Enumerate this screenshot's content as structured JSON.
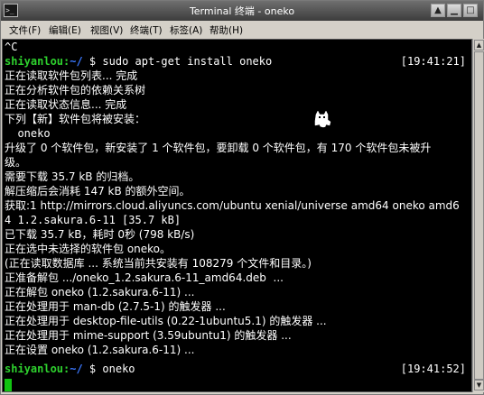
{
  "window": {
    "title": "Terminal 终端 - oneko",
    "app_icon_text": ">_",
    "controls": {
      "shade": "▲",
      "minimize": "▁",
      "maximize": "□",
      "close": "✕"
    }
  },
  "menu": [
    "文件(F)",
    "编辑(E)",
    "视图(V)",
    "终端(T)",
    "标签(A)",
    "帮助(H)"
  ],
  "terminal": {
    "prompt_user": "shiyanlou:",
    "prompt_path": "~/",
    "prompt_symbol": " $ ",
    "lines": [
      "^C",
      "",
      "正在读取软件包列表... 完成",
      "正在分析软件包的依赖关系树",
      "正在读取状态信息... 完成",
      "下列【新】软件包将被安装：",
      "  oneko",
      "升级了 0 个软件包，新安装了 1 个软件包，要卸载 0 个软件包，有 170 个软件包未被升",
      "级。",
      "需要下载 35.7 kB 的归档。",
      "解压缩后会消耗 147 kB 的额外空间。",
      "获取:1 http://mirrors.cloud.aliyuncs.com/ubuntu xenial/universe amd64 oneko amd6",
      "4 1.2.sakura.6-11 [35.7 kB]",
      "已下载 35.7 kB，耗时 0秒 (798 kB/s)",
      "正在选中未选择的软件包 oneko。",
      "(正在读取数据库 ... 系统当前共安装有 108279 个文件和目录。)",
      "正准备解包 .../oneko_1.2.sakura.6-11_amd64.deb  ...",
      "正在解包 oneko (1.2.sakura.6-11) ...",
      "正在处理用于 man-db (2.7.5-1) 的触发器 ...",
      "正在处理用于 desktop-file-utils (0.22-1ubuntu5.1) 的触发器 ...",
      "正在处理用于 mime-support (3.59ubuntu1) 的触发器 ...",
      "正在设置 oneko (1.2.sakura.6-11) ...",
      ""
    ],
    "command1": "sudo apt-get install oneko",
    "time1": "[19:41:21]",
    "command2": "oneko",
    "time2": "[19:41:52]"
  },
  "colors": {
    "prompt_user": "#2ed12e",
    "prompt_path": "#3b78ff",
    "cursor": "#11c411",
    "terminal_bg": "#000000"
  },
  "icons": {
    "cat": "oneko-cat-icon"
  }
}
